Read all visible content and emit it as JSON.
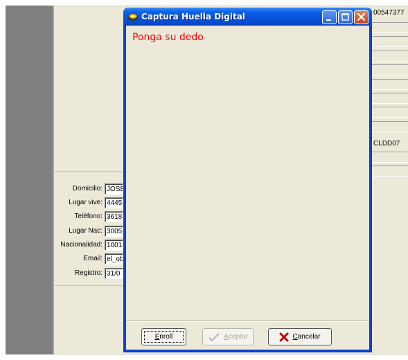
{
  "dialog": {
    "title": "Captura Huella Digital",
    "prompt": "Ponga su dedo",
    "buttons": {
      "enroll": "Enroll",
      "accept": "Aceptar",
      "cancel": "Cancelar"
    }
  },
  "form": {
    "fields": [
      {
        "label": "Domicilio:",
        "value": "JOSE"
      },
      {
        "label": "Lugar vive:",
        "value": "4445"
      },
      {
        "label": "Teléfono:",
        "value": "3618"
      },
      {
        "label": "Lugar Nac:",
        "value": "3005"
      },
      {
        "label": "Nacionalidad:",
        "value": "1001"
      },
      {
        "label": "Email:",
        "value": "el_ob"
      },
      {
        "label": "Registro:",
        "value": "31/0"
      }
    ]
  },
  "right_column": {
    "top_value": "00547377",
    "mid_value": "CLDD07"
  },
  "colors": {
    "title_bar": "#0553d8",
    "prompt": "#ff0000",
    "dialog_bg": "#ece9d8",
    "cancel_icon": "#c00000",
    "accept_icon": "#aca899"
  },
  "icons": {
    "dialog_icon": "fingerprint-reader-icon",
    "accept_icon": "checkmark-icon",
    "cancel_icon": "x-icon",
    "minimize": "minimize-icon",
    "maximize": "maximize-icon",
    "close": "close-icon"
  }
}
